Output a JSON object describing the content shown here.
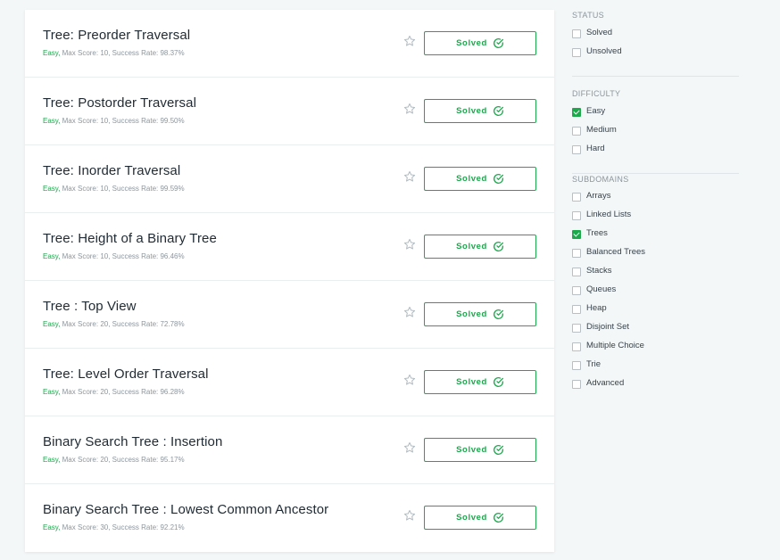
{
  "challenges": [
    {
      "title": "Tree: Preorder Traversal",
      "difficulty": "Easy,",
      "meta": " Max Score: 10, Success Rate: 98.37%",
      "status": "Solved"
    },
    {
      "title": "Tree: Postorder Traversal",
      "difficulty": "Easy,",
      "meta": " Max Score: 10, Success Rate: 99.50%",
      "status": "Solved"
    },
    {
      "title": "Tree: Inorder Traversal",
      "difficulty": "Easy,",
      "meta": " Max Score: 10, Success Rate: 99.59%",
      "status": "Solved"
    },
    {
      "title": "Tree: Height of a Binary Tree",
      "difficulty": "Easy,",
      "meta": " Max Score: 10, Success Rate: 96.46%",
      "status": "Solved"
    },
    {
      "title": "Tree : Top View",
      "difficulty": "Easy,",
      "meta": " Max Score: 20, Success Rate: 72.78%",
      "status": "Solved"
    },
    {
      "title": "Tree: Level Order Traversal",
      "difficulty": "Easy,",
      "meta": " Max Score: 20, Success Rate: 96.28%",
      "status": "Solved"
    },
    {
      "title": "Binary Search Tree : Insertion",
      "difficulty": "Easy,",
      "meta": " Max Score: 20, Success Rate: 95.17%",
      "status": "Solved"
    },
    {
      "title": "Binary Search Tree : Lowest Common Ancestor",
      "difficulty": "Easy,",
      "meta": " Max Score: 30, Success Rate: 92.21%",
      "status": "Solved"
    }
  ],
  "filters": {
    "status": {
      "title": "STATUS",
      "options": [
        {
          "label": "Solved",
          "checked": false
        },
        {
          "label": "Unsolved",
          "checked": false
        }
      ]
    },
    "difficulty": {
      "title": "DIFFICULTY",
      "options": [
        {
          "label": "Easy",
          "checked": true
        },
        {
          "label": "Medium",
          "checked": false
        },
        {
          "label": "Hard",
          "checked": false
        }
      ]
    },
    "subdomains": {
      "title": "SUBDOMAINS",
      "options": [
        {
          "label": "Arrays",
          "checked": false
        },
        {
          "label": "Linked Lists",
          "checked": false
        },
        {
          "label": "Trees",
          "checked": true
        },
        {
          "label": "Balanced Trees",
          "checked": false
        },
        {
          "label": "Stacks",
          "checked": false
        },
        {
          "label": "Queues",
          "checked": false
        },
        {
          "label": "Heap",
          "checked": false
        },
        {
          "label": "Disjoint Set",
          "checked": false
        },
        {
          "label": "Multiple Choice",
          "checked": false
        },
        {
          "label": "Trie",
          "checked": false
        },
        {
          "label": "Advanced",
          "checked": false
        }
      ]
    }
  },
  "colors": {
    "accent": "#1ba94c",
    "star": "#b3bcc2"
  },
  "icons": {
    "star": "star-icon",
    "solved": "check-circle-icon"
  }
}
